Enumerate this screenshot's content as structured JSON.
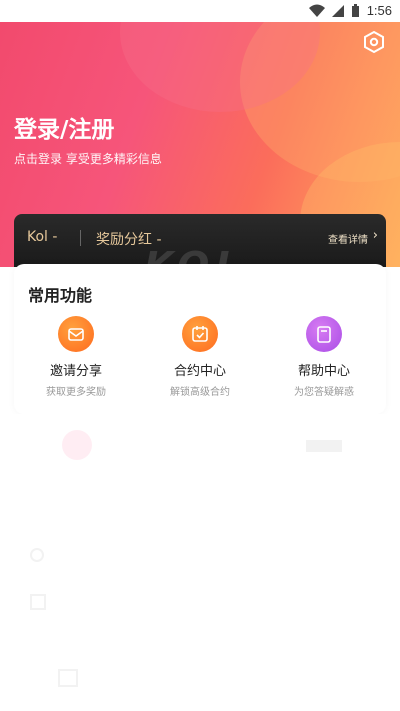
{
  "status_bar": {
    "time": "1:56"
  },
  "header": {
    "title": "登录/注册",
    "subtitle": "点击登录 享受更多精彩信息"
  },
  "member_card": {
    "kol_label": "Kol -",
    "bonus_label": "奖励分红 -",
    "detail_link": "查看详情",
    "watermark": "KOL"
  },
  "functions": {
    "title": "常用功能",
    "items": [
      {
        "label": "邀请分享",
        "sub": "获取更多奖励",
        "icon": "share-envelope-icon"
      },
      {
        "label": "合约中心",
        "sub": "解锁高级合约",
        "icon": "contract-calendar-icon"
      },
      {
        "label": "帮助中心",
        "sub": "为您答疑解惑",
        "icon": "help-book-icon"
      }
    ]
  },
  "colors": {
    "hero_start": "#f24a6d",
    "hero_end": "#ffab5a",
    "gold_text": "#e6c89b",
    "icon_orange": "#ff7a2a",
    "icon_purple": "#b258ea"
  }
}
